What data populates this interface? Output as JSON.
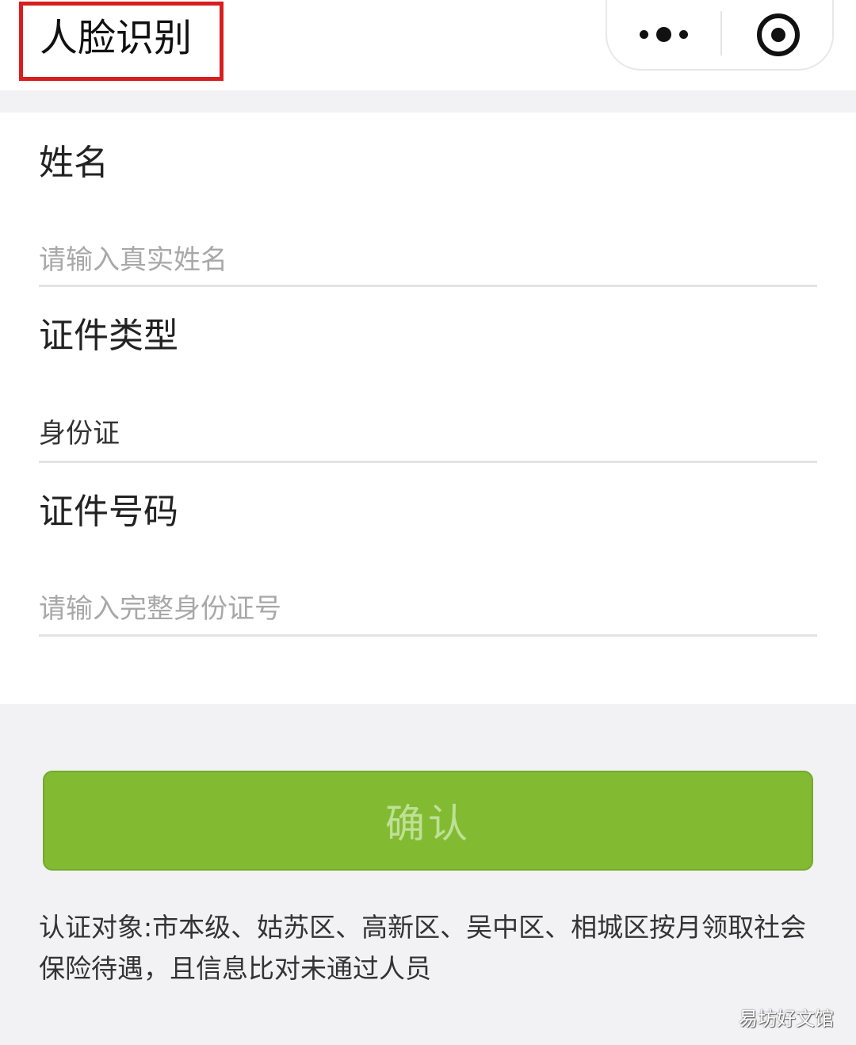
{
  "header": {
    "title": "人脸识别"
  },
  "capsule": {
    "more_icon": "more-dots-icon",
    "close_icon": "target-close-icon"
  },
  "form": {
    "name": {
      "label": "姓名",
      "placeholder": "请输入真实姓名"
    },
    "id_type": {
      "label": "证件类型",
      "value": "身份证"
    },
    "id_number": {
      "label": "证件号码",
      "placeholder": "请输入完整身份证号"
    }
  },
  "confirm_label": "确认",
  "notice": "认证对象:市本级、姑苏区、高新区、吴中区、相城区按月领取社会保险待遇，且信息比对未通过人员",
  "watermark": "易坊好文馆",
  "colors": {
    "accent": "#82bb32",
    "highlight_box": "#d81e1e"
  }
}
